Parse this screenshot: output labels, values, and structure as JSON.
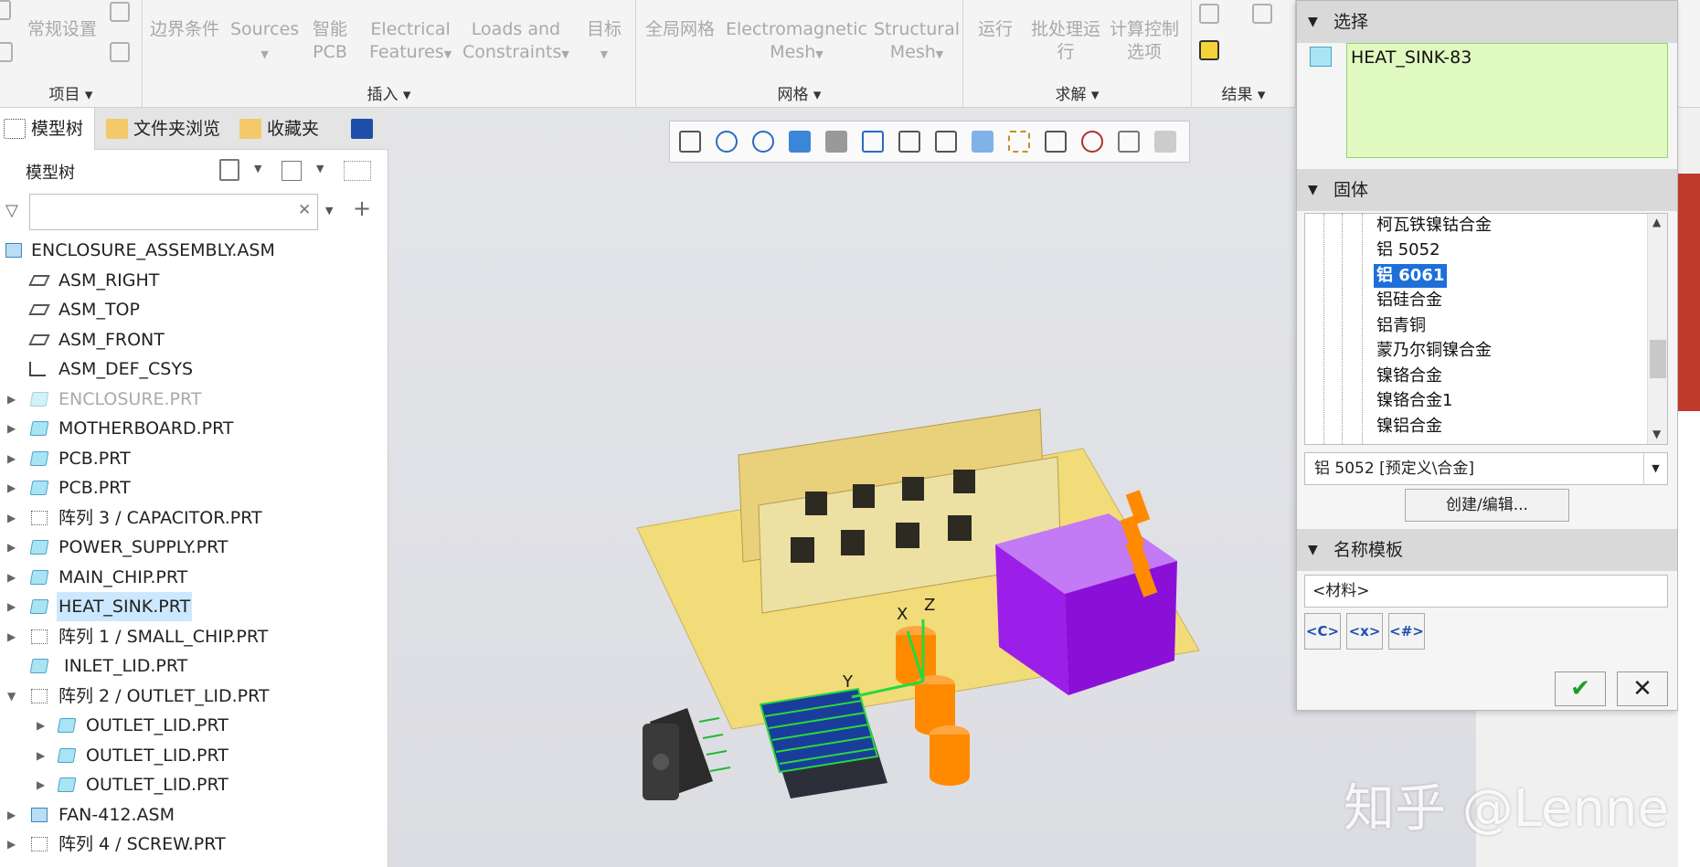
{
  "ribbon": {
    "groups": [
      {
        "label": "项目 ▾"
      },
      {
        "label": "插入 ▾"
      },
      {
        "label": "网格 ▾"
      },
      {
        "label": "求解 ▾"
      },
      {
        "label": "结果 ▾"
      }
    ],
    "buttons": {
      "general_settings": "常规设置",
      "boundary": "边界条件",
      "sources": "Sources",
      "smart_pcb_1": "智能",
      "smart_pcb_2": "PCB",
      "elec_1": "Electrical",
      "elec_2": "Features",
      "loads_1": "Loads and",
      "loads_2": "Constraints",
      "target": "目标",
      "global_mesh": "全局网格",
      "em_1": "Electromagnetic",
      "em_2": "Mesh",
      "struct_1": "Structural",
      "struct_2": "Mesh",
      "run": "运行",
      "batch_1": "批处理运",
      "batch_2": "行",
      "calc_1": "计算控制",
      "calc_2": "选项"
    }
  },
  "left": {
    "tabs": [
      "模型树",
      "文件夹浏览",
      "收藏夹"
    ],
    "tree_header": "模型树",
    "filter_value": "",
    "items": [
      {
        "label": "ENCLOSURE_ASSEMBLY.ASM"
      },
      {
        "label": "ASM_RIGHT"
      },
      {
        "label": "ASM_TOP"
      },
      {
        "label": "ASM_FRONT"
      },
      {
        "label": "ASM_DEF_CSYS"
      },
      {
        "label": "ENCLOSURE.PRT"
      },
      {
        "label": "MOTHERBOARD.PRT"
      },
      {
        "label": "PCB.PRT"
      },
      {
        "label": "PCB.PRT"
      },
      {
        "label": "阵列 3 / CAPACITOR.PRT"
      },
      {
        "label": "POWER_SUPPLY.PRT"
      },
      {
        "label": "MAIN_CHIP.PRT"
      },
      {
        "label": "HEAT_SINK.PRT"
      },
      {
        "label": "阵列 1 / SMALL_CHIP.PRT"
      },
      {
        "label": "INLET_LID.PRT"
      },
      {
        "label": "阵列 2 / OUTLET_LID.PRT"
      },
      {
        "label": "OUTLET_LID.PRT"
      },
      {
        "label": "OUTLET_LID.PRT"
      },
      {
        "label": "OUTLET_LID.PRT"
      },
      {
        "label": "FAN-412.ASM"
      },
      {
        "label": "阵列 4 / SCREW.PRT"
      }
    ]
  },
  "viewport": {
    "axis_labels": {
      "x": "X",
      "y": "Y",
      "z": "Z"
    }
  },
  "dialog": {
    "sections": {
      "select": "选择",
      "solid": "固体",
      "name_template": "名称模板"
    },
    "selected_item": "HEAT_SINK-83",
    "materials": [
      "柯瓦铁镍钴合金",
      "铝 5052",
      "铝 6061",
      "铝硅合金",
      "铝青铜",
      "蒙乃尔铜镍合金",
      "镍铬合金",
      "镍铬合金1",
      "镍铝合金"
    ],
    "material_selected": "铝 6061",
    "material_combo": "铝 5052 [预定义\\合金]",
    "create_edit": "创建/编辑...",
    "template_value": "<材料>",
    "template_buttons": [
      "<C>",
      "<x>",
      "<#>"
    ],
    "ok": "✔",
    "cancel": "✕"
  },
  "watermark": "知乎 @Lenne",
  "colors": {
    "accent": "#1e6fd9",
    "selection_field": "#e0f9c0",
    "pcb": "#f2dc7a",
    "power_supply": "#9b1fe8",
    "capacitor": "#ff8a00"
  }
}
